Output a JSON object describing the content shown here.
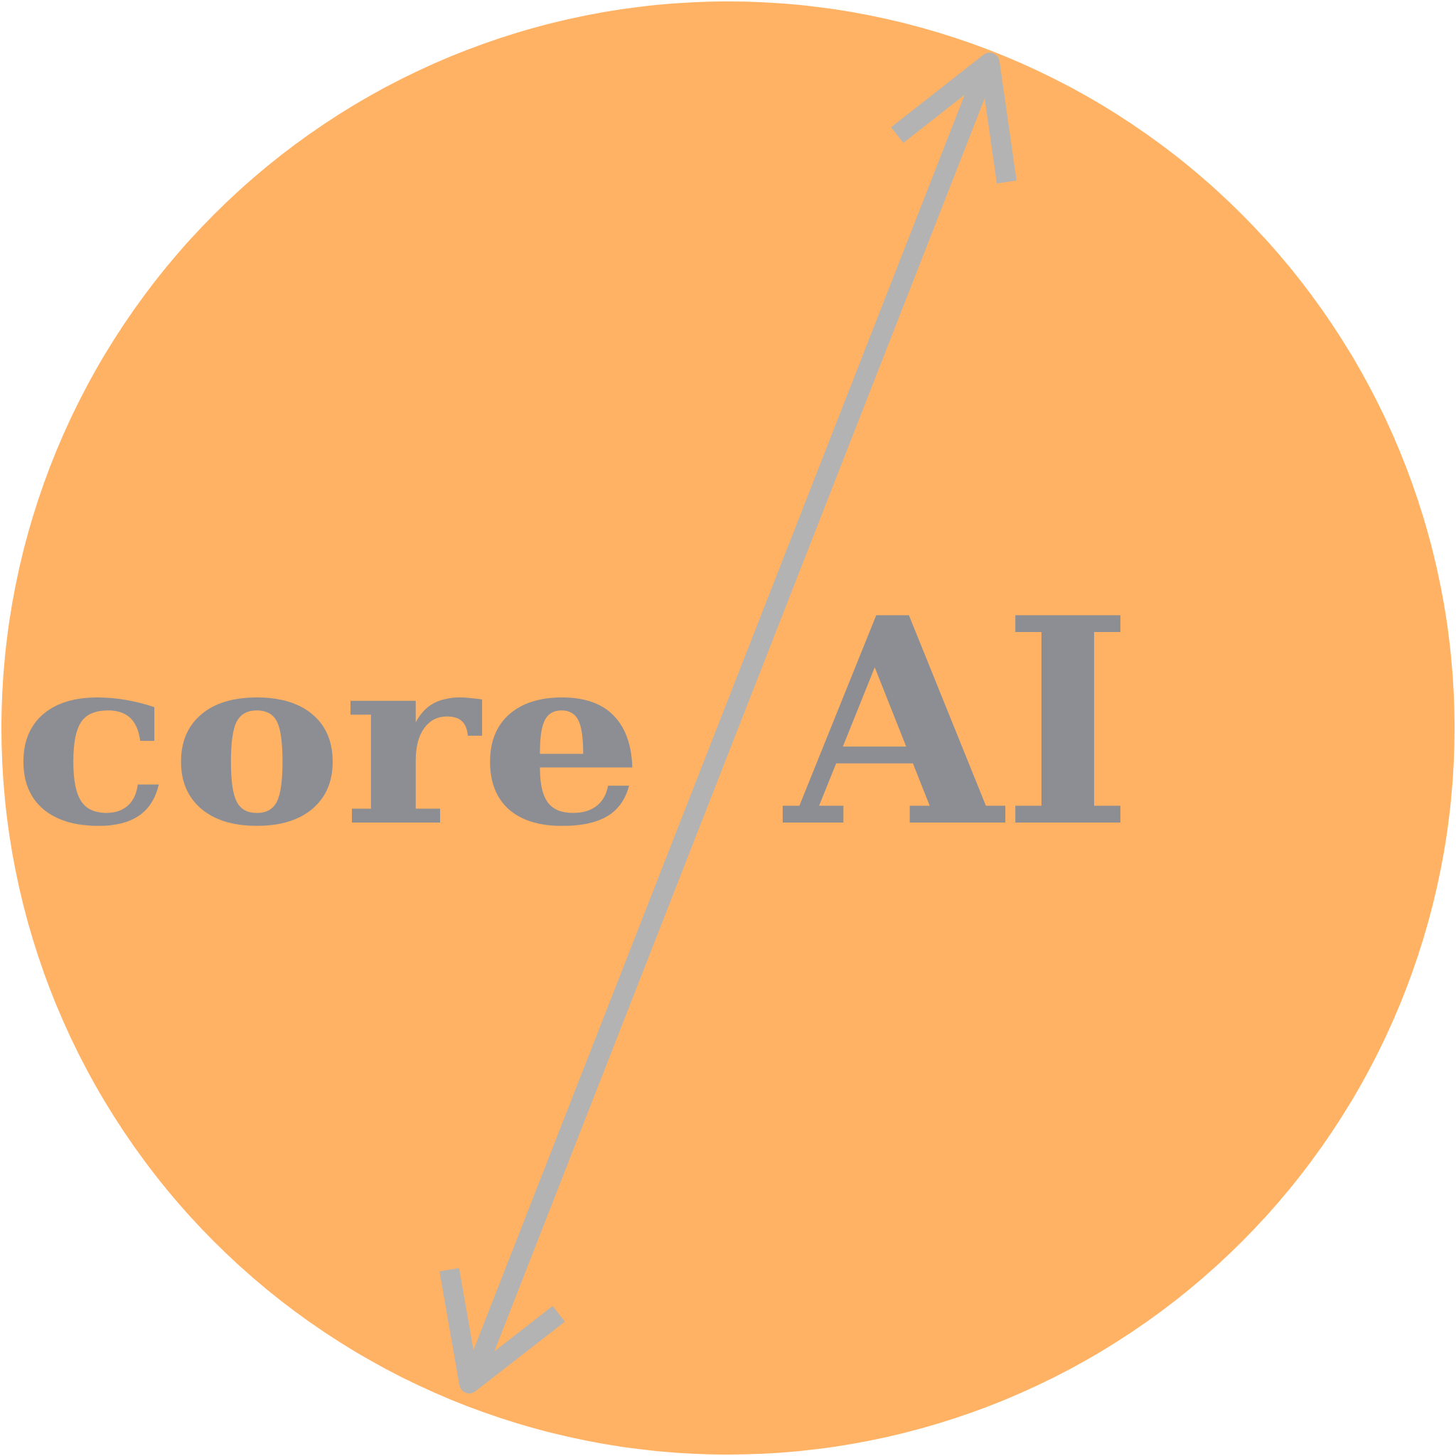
{
  "logo": {
    "word_left": "core",
    "word_right": "AI",
    "background_color": "#FFB263",
    "text_color": "#8D8E93",
    "arrow_color": "#B3B3B3",
    "icon": "double-headed-arrow-icon"
  }
}
